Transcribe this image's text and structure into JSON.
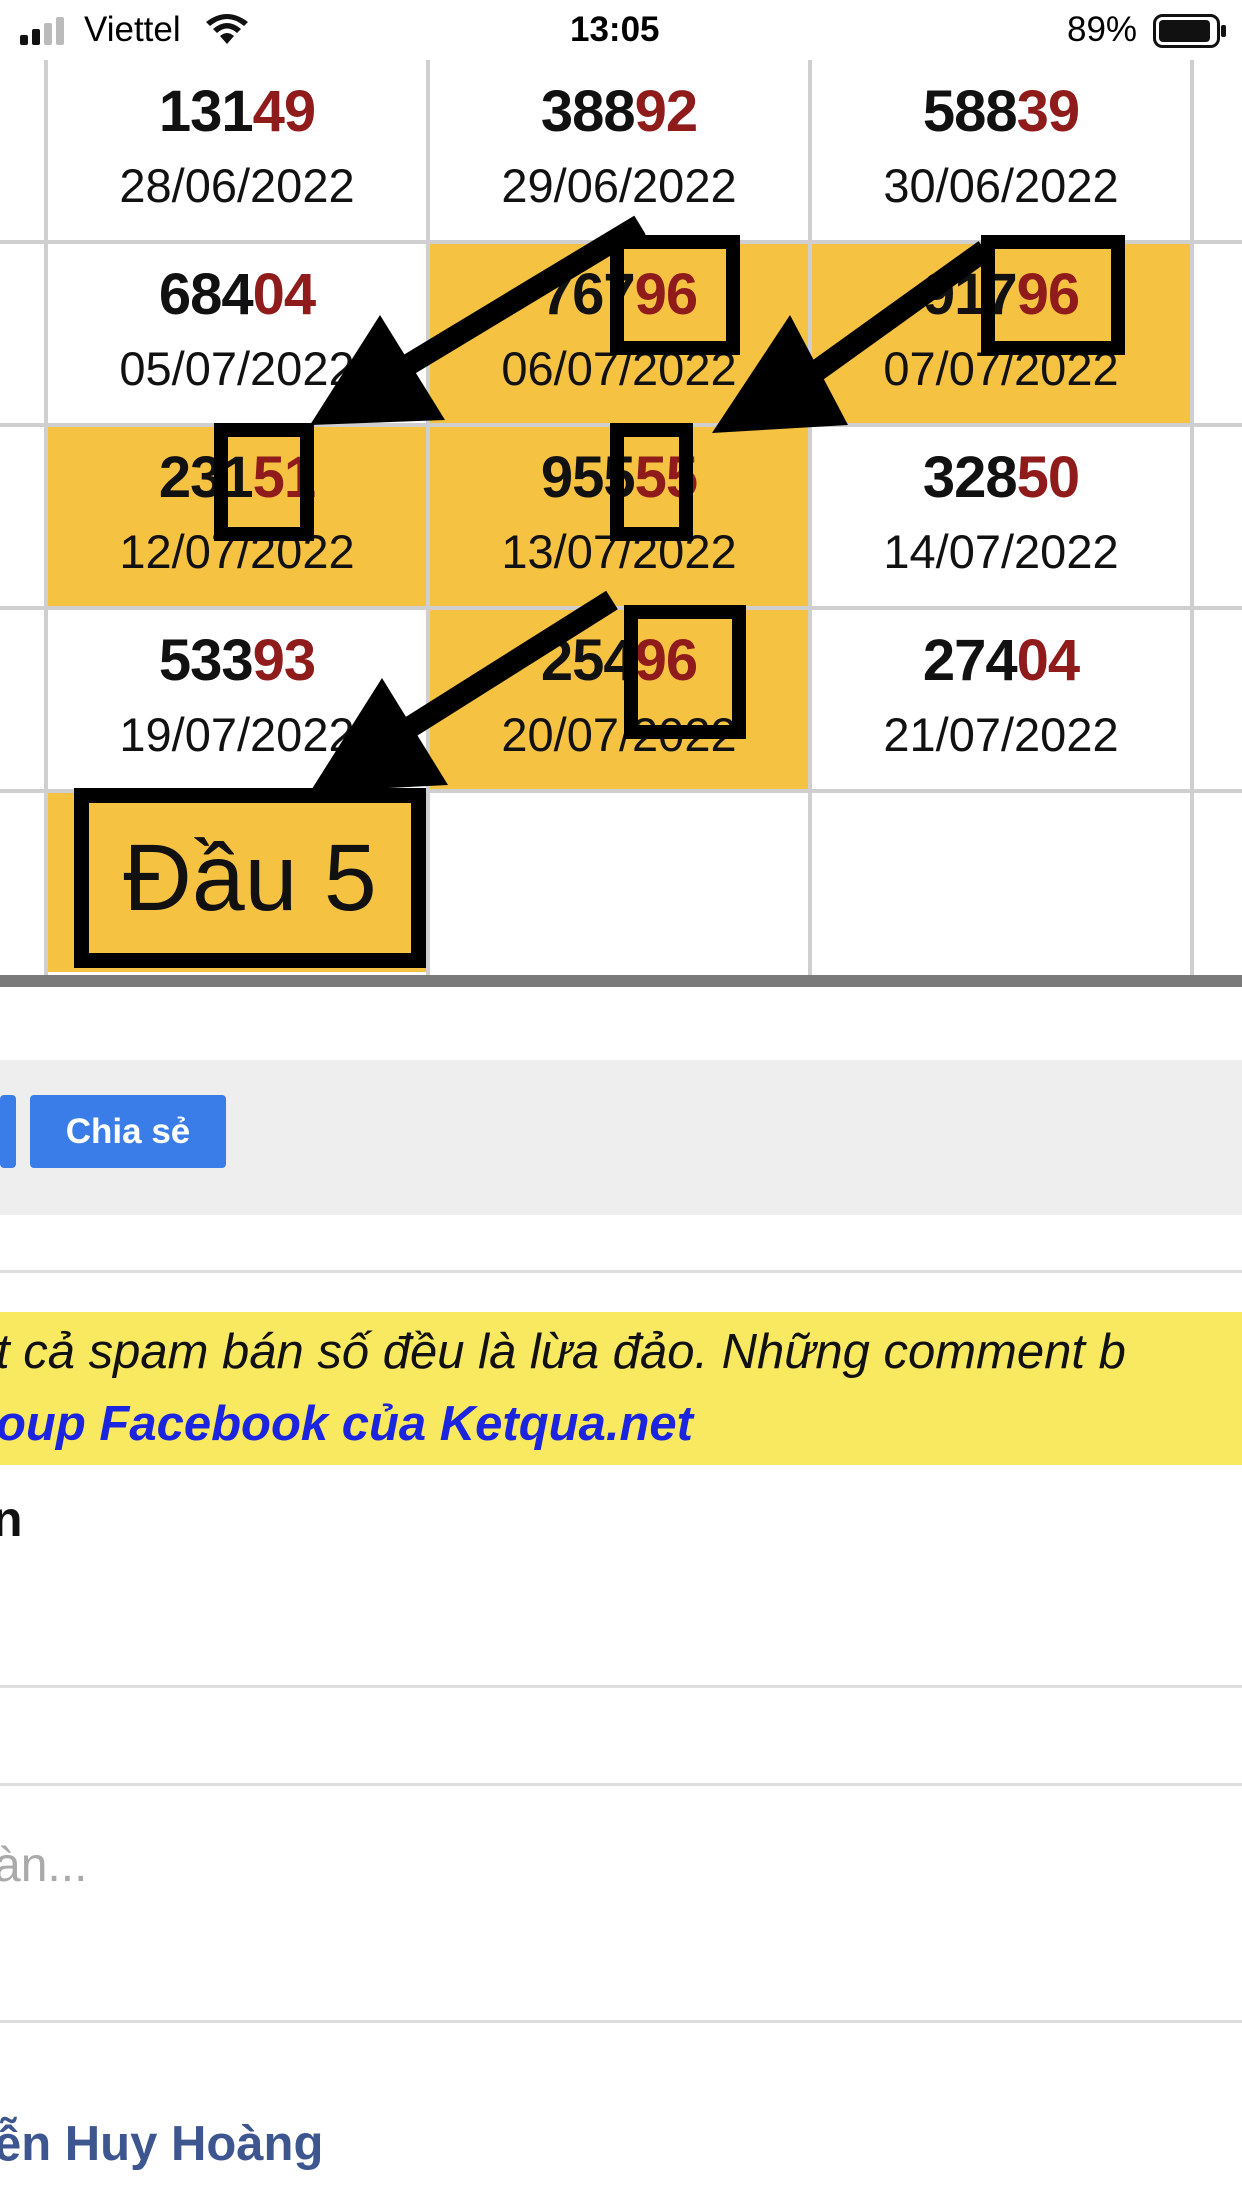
{
  "status_bar": {
    "carrier": "Viettel",
    "time": "13:05",
    "battery": "89%",
    "icons": [
      "signal-icon",
      "wifi-icon",
      "battery-icon"
    ]
  },
  "results": [
    {
      "head": "131",
      "tail": "49",
      "date": "28/06/2022",
      "highlight": false
    },
    {
      "head": "388",
      "tail": "92",
      "date": "29/06/2022",
      "highlight": false
    },
    {
      "head": "588",
      "tail": "39",
      "date": "30/06/2022",
      "highlight": false
    },
    {
      "head": "684",
      "tail": "04",
      "date": "05/07/2022",
      "highlight": false
    },
    {
      "head": "767",
      "tail": "96",
      "date": "06/07/2022",
      "highlight": true
    },
    {
      "head": "917",
      "tail": "96",
      "date": "07/07/2022",
      "highlight": true
    },
    {
      "head": "231",
      "tail": "51",
      "date": "12/07/2022",
      "highlight": true
    },
    {
      "head": "955",
      "tail": "55",
      "date": "13/07/2022",
      "highlight": true
    },
    {
      "head": "328",
      "tail": "50",
      "date": "14/07/2022",
      "highlight": false
    },
    {
      "head": "533",
      "tail": "93",
      "date": "19/07/2022",
      "highlight": false
    },
    {
      "head": "254",
      "tail": "96",
      "date": "20/07/2022",
      "highlight": true
    },
    {
      "head": "274",
      "tail": "04",
      "date": "21/07/2022",
      "highlight": false
    }
  ],
  "annotation": {
    "label": "Đầu 5"
  },
  "share_button": "Chia sẻ",
  "notice": {
    "line1": "t cả spam bán số đều là lừa đảo. Những comment b",
    "line2": "oup Facebook của Ketqua.net"
  },
  "clipped_text": "n",
  "comment_placeholder": "àn...",
  "commenter_name": "ễn Huy Hoàng",
  "colors": {
    "highlight": "#f5c242",
    "tail_digits": "#8f1b1b",
    "share_button": "#3b7de8",
    "notice_bg": "#f9e960",
    "notice_link": "#1b25e0",
    "commenter": "#3d5690"
  }
}
